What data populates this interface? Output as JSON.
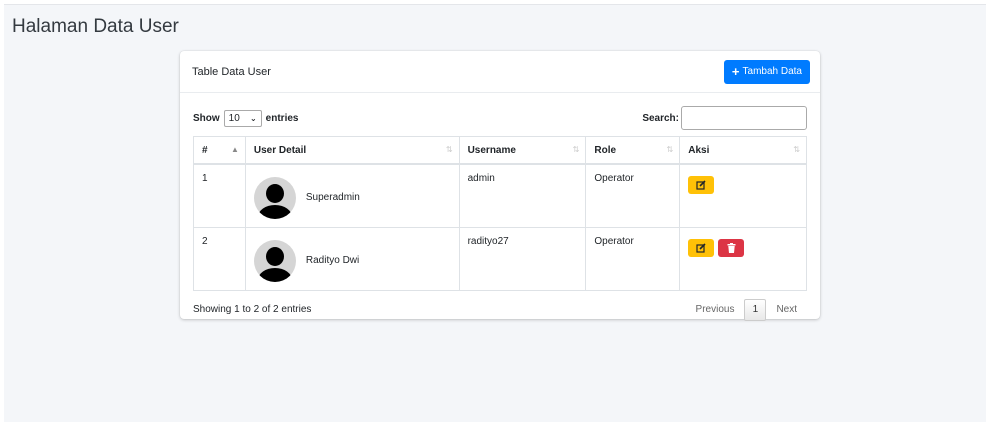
{
  "page": {
    "title": "Halaman Data User"
  },
  "card": {
    "title": "Table Data User",
    "add_button": {
      "icon": "plus-icon",
      "label": "Tambah Data"
    }
  },
  "controls": {
    "show_label": "Show",
    "length_value": "10",
    "entries_label": "entries",
    "search_label": "Search:",
    "search_value": ""
  },
  "table": {
    "columns": [
      "#",
      "User Detail",
      "Username",
      "Role",
      "Aksi"
    ],
    "rows": [
      {
        "no": "1",
        "name": "Superadmin",
        "username": "admin",
        "role": "Operator",
        "actions": [
          "edit"
        ]
      },
      {
        "no": "2",
        "name": "Radityo Dwi",
        "username": "radityo27",
        "role": "Operator",
        "actions": [
          "edit",
          "delete"
        ]
      }
    ]
  },
  "footer": {
    "info": "Showing 1 to 2 of 2 entries",
    "previous": "Previous",
    "current_page": "1",
    "next": "Next"
  },
  "colors": {
    "primary": "#007bff",
    "warning": "#ffc107",
    "danger": "#dc3545",
    "background": "#f4f6f9"
  }
}
